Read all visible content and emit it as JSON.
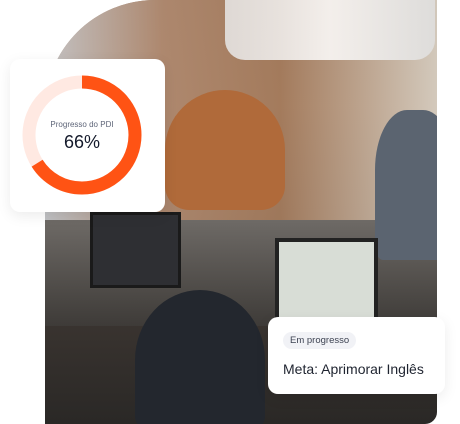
{
  "progress_card": {
    "label": "Progresso do PDI",
    "value_text": "66%",
    "progress_percent": 66
  },
  "goal_card": {
    "status_badge": "Em progresso",
    "goal_title": "Meta: Aprimorar Inglês"
  },
  "colors": {
    "accent": "#ff5314",
    "track": "#ffe9e2"
  }
}
